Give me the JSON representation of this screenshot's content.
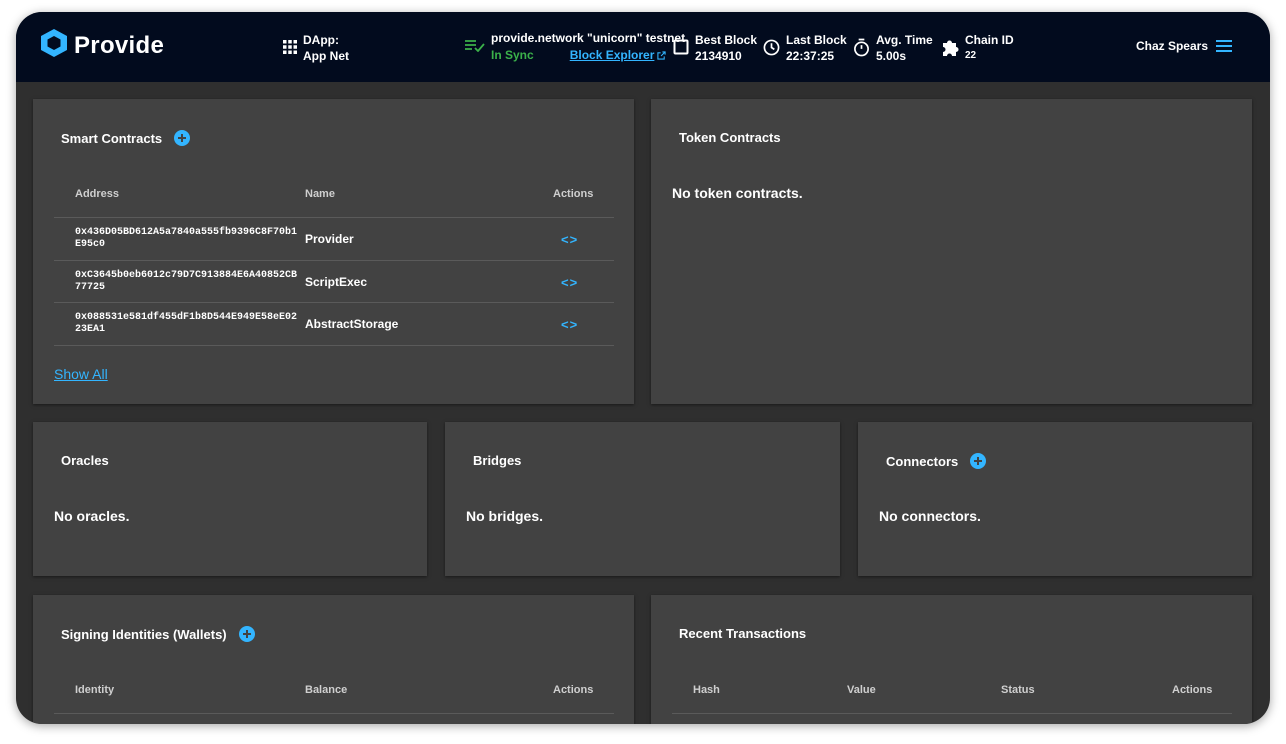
{
  "header": {
    "logo_text": "Provide",
    "dapp_label": "DApp:",
    "dapp_value": "App Net",
    "network_name": "provide.network \"unicorn\" testnet",
    "sync_status": "In Sync",
    "explorer_link": "Block Explorer",
    "best_block_label": "Best Block",
    "best_block_value": "2134910",
    "last_block_label": "Last Block",
    "last_block_value": "22:37:25",
    "avg_time_label": "Avg. Time",
    "avg_time_value": "5.00s",
    "chain_id_label": "Chain ID",
    "chain_id_value": "22",
    "user_name": "Chaz Spears",
    "icons": [
      "provide-logo-icon",
      "apps-grid-icon",
      "sync-list-icon",
      "external-link-icon",
      "block-square-icon",
      "clock-icon",
      "stopwatch-icon",
      "puzzle-icon",
      "menu-icon"
    ]
  },
  "smart_contracts": {
    "title": "Smart Contracts",
    "columns": [
      "Address",
      "Name",
      "Actions"
    ],
    "rows": [
      {
        "address": "0x436D05BD612A5a7840a555fb9396C8F70b1E95c0",
        "name": "Provider",
        "action": "<>"
      },
      {
        "address": "0xC3645b0eb6012c79D7C913884E6A40852CB77725",
        "name": "ScriptExec",
        "action": "<>"
      },
      {
        "address": "0x088531e581df455dF1b8D544E949E58eE0223EA1",
        "name": "AbstractStorage",
        "action": "<>"
      }
    ],
    "show_all": "Show All"
  },
  "token_contracts": {
    "title": "Token Contracts",
    "empty": "No token contracts."
  },
  "oracles": {
    "title": "Oracles",
    "empty": "No oracles."
  },
  "bridges": {
    "title": "Bridges",
    "empty": "No bridges."
  },
  "connectors": {
    "title": "Connectors",
    "empty": "No connectors."
  },
  "signing_identities": {
    "title": "Signing Identities (Wallets)",
    "columns": [
      "Identity",
      "Balance",
      "Actions"
    ]
  },
  "recent_transactions": {
    "title": "Recent Transactions",
    "columns": [
      "Hash",
      "Value",
      "Status",
      "Actions"
    ]
  },
  "colors": {
    "accent": "#33b5ff",
    "sync": "#3bb14a",
    "topbar": "#020b1e",
    "panel": "#424242",
    "background": "#2f2f2f"
  }
}
